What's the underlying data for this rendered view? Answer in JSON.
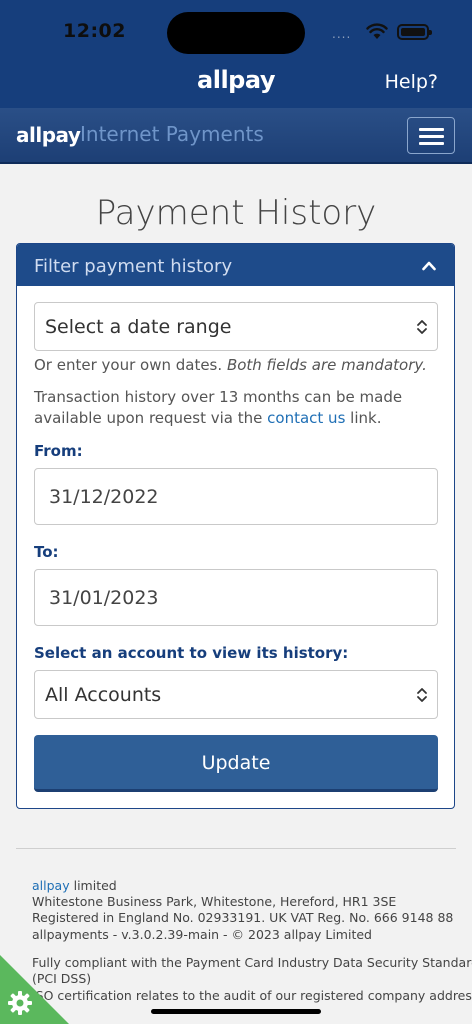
{
  "status": {
    "time": "12:02",
    "signal": "...."
  },
  "app_header": {
    "brand": "allpay",
    "help": "Help?"
  },
  "nav": {
    "logo": "allpay",
    "subtitle": "Internet Payments"
  },
  "page": {
    "title": "Payment History"
  },
  "filter": {
    "heading": "Filter payment history",
    "date_range_select": "Select a date range",
    "own_dates_prefix": "Or enter your own dates.",
    "own_dates_emph": "Both fields are mandatory.",
    "history_line1": "Transaction history over 13 months can be made",
    "history_line2_prefix": "available upon request via the",
    "contact_link": "contact us",
    "history_line2_suffix": "link.",
    "from_label": "From:",
    "from_value": "31/12/2022",
    "to_label": "To:",
    "to_value": "31/01/2023",
    "account_label": "Select an account to view its history:",
    "account_select": "All Accounts",
    "update_button": "Update"
  },
  "footer": {
    "company_link": "allpay",
    "company_suffix": "limited",
    "address": "Whitestone Business Park, Whitestone, Hereford, HR1 3SE",
    "registration": "Registered in England No. 02933191. UK VAT Reg. No. 666 9148 88",
    "version": "allpayments - v.3.0.2.39-main - © 2023 allpay Limited",
    "pci_line1": "Fully compliant with the Payment Card Industry Data Security Standard",
    "pci_line2": "(PCI DSS)",
    "iso_line": "ISO certification relates to the audit of our registered company address"
  },
  "colors": {
    "brand_blue": "#163e7c",
    "button_blue": "#2f5f97",
    "link_blue": "#1f6fb5",
    "gear_green": "#5bb85d"
  }
}
